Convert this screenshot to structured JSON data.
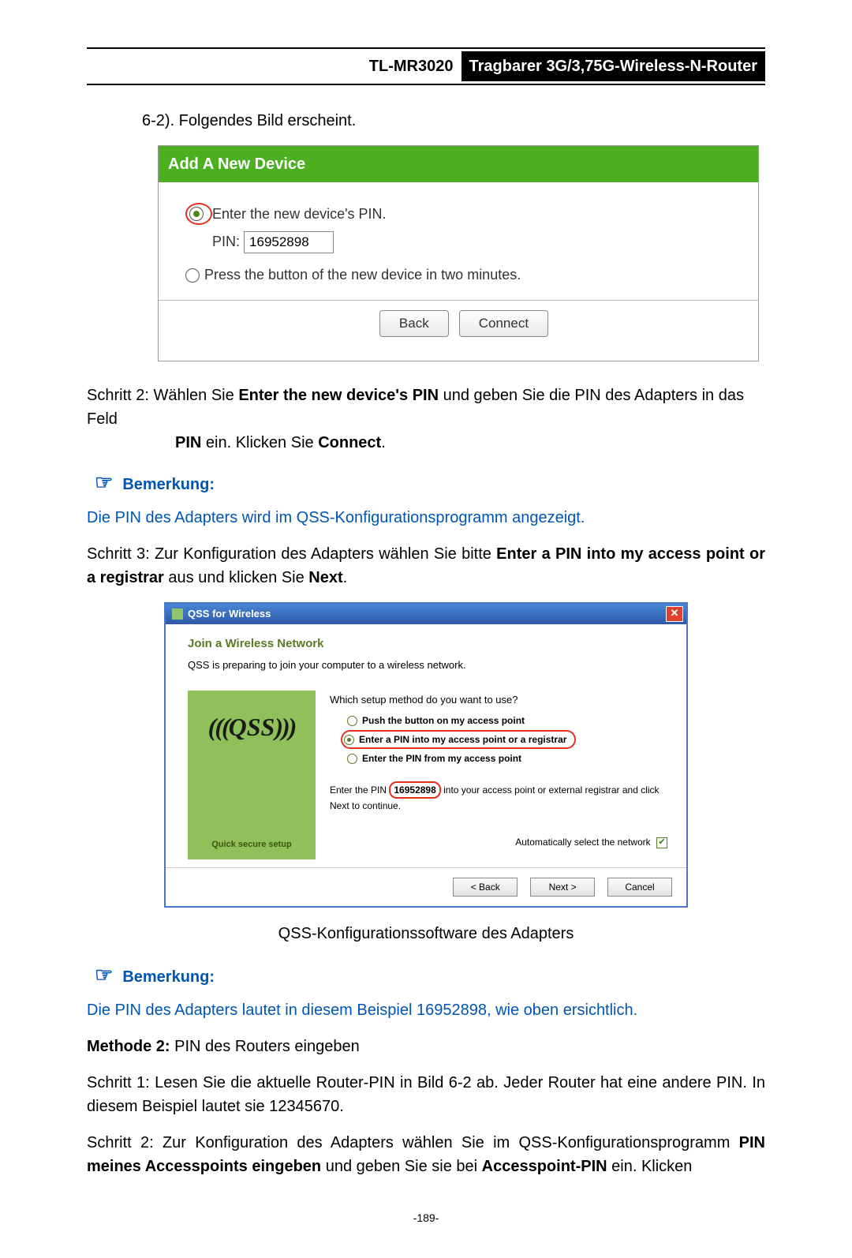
{
  "header": {
    "model": "TL-MR3020",
    "name": "Tragbarer 3G/3,75G-Wireless-N-Router"
  },
  "line1": "6-2). Folgendes Bild erscheint.",
  "router": {
    "title": "Add A New Device",
    "opt1": "Enter the new device's PIN.",
    "pin_label": "PIN:",
    "pin_value": "16952898",
    "opt2": "Press the button of the new device in two minutes.",
    "btn_back": "Back",
    "btn_connect": "Connect"
  },
  "step2a": "Schritt 2:  Wählen Sie ",
  "step2b": "Enter the new device's PIN",
  "step2c": " und geben Sie die PIN des Adapters in das Feld ",
  "step2d": "PIN",
  "step2e": " ein. Klicken Sie ",
  "step2f": "Connect",
  "step2g": ".",
  "note_label": "Bemerkung:",
  "note1_text": "Die PIN des Adapters wird im QSS-Konfigurationsprogramm angezeigt.",
  "step3a": "Schritt 3:  Zur Konfiguration des Adapters wählen Sie bitte ",
  "step3b": "Enter a PIN into my access point or a registrar",
  "step3c": " aus und klicken Sie ",
  "step3d": "Next",
  "step3e": ".",
  "qss": {
    "win_title": "QSS for Wireless",
    "heading": "Join a Wireless Network",
    "sub": "QSS is preparing to join your computer to a wireless network.",
    "left_label": "Quick secure setup",
    "question": "Which setup method do you want to use?",
    "o1": "Push the button on my access point",
    "o2": "Enter a PIN into my access point or a registrar",
    "o3": "Enter the PIN from my access point",
    "explain_a": "Enter the PIN ",
    "explain_pin": "16952898",
    "explain_b": " into your access point or external registrar and click Next to continue.",
    "auto": "Automatically select the network",
    "btn_back": "< Back",
    "btn_next": "Next >",
    "btn_cancel": "Cancel"
  },
  "caption": "QSS-Konfigurationssoftware des Adapters",
  "note2_text": "Die PIN des Adapters lautet in diesem Beispiel 16952898, wie oben ersichtlich.",
  "m2a": "Methode 2:",
  "m2b": " PIN des Routers eingeben",
  "m2_s1": "Schritt 1:  Lesen Sie die aktuelle Router-PIN in Bild 6-2 ab. Jeder Router hat eine andere PIN. In diesem Beispiel lautet sie 12345670.",
  "m2_s2a": "Schritt 2:  Zur  Konfiguration  des  Adapters  wählen  Sie  im  QSS-Konfigurationsprogramm ",
  "m2_s2b": "PIN meines Accesspoints eingeben",
  "m2_s2c": " und geben Sie sie bei ",
  "m2_s2d": "Accesspoint-PIN",
  "m2_s2e": " ein. Klicken",
  "page_no": "-189-"
}
